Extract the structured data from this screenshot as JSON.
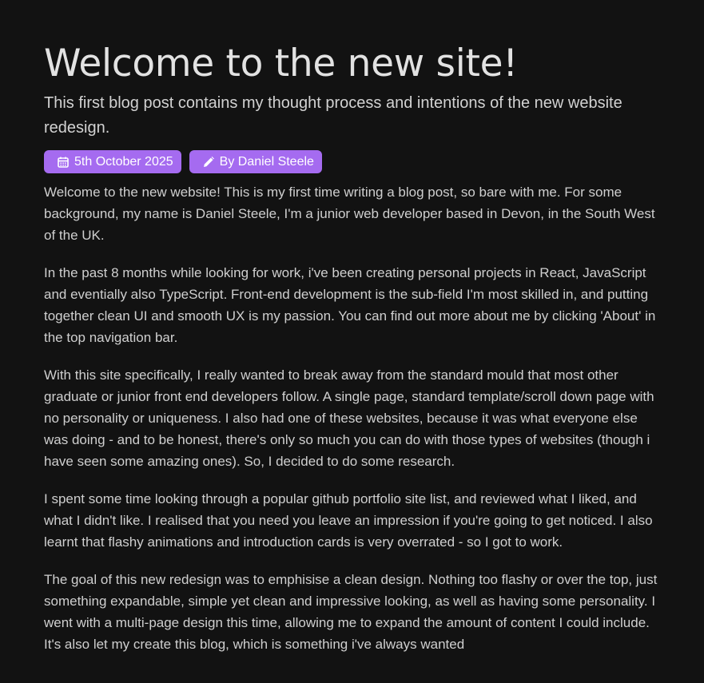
{
  "post": {
    "title": "Welcome to the new site!",
    "subtitle": "This first blog post contains my thought process and intentions of the new website redesign.",
    "meta": {
      "date": "5th October 2025",
      "author": "By Daniel Steele",
      "date_icon": "calendar-icon",
      "author_icon": "pencil-icon",
      "badge_color": "#a56bf0"
    },
    "paragraphs": [
      "Welcome to the new website! This is my first time writing a blog post, so bare with me. For some background, my name is Daniel Steele, I'm a junior web developer based in Devon, in the South West of the UK.",
      "In the past 8 months while looking for work, i've been creating personal projects in React, JavaScript and eventially also TypeScript. Front-end development is the sub-field I'm most skilled in, and putting together clean UI and smooth UX is my passion. You can find out more about me by clicking 'About' in the top navigation bar.",
      "With this site specifically, I really wanted to break away from the standard mould that most other graduate or junior front end developers follow. A single page, standard template/scroll down page with no personality or uniqueness. I also had one of these websites, because it was what everyone else was doing - and to be honest, there's only so much you can do with those types of websites (though i have seen some amazing ones). So, I decided to do some research.",
      "I spent some time looking through a popular github portfolio site list, and reviewed what I liked, and what I didn't like. I realised that you need you leave an impression if you're going to get noticed. I also learnt that flashy animations and introduction cards is very overrated - so I got to work.",
      "The goal of this new redesign was to emphisise a clean design. Nothing too flashy or over the top, just something expandable, simple yet clean and impressive looking, as well as having some personality. I went with a multi-page design this time, allowing me to expand the amount of content I could include. It's also let my create this blog, which is something i've always wanted"
    ]
  },
  "theme": {
    "background": "#121212",
    "text": "#cfcfcf",
    "accent": "#a56bf0"
  }
}
